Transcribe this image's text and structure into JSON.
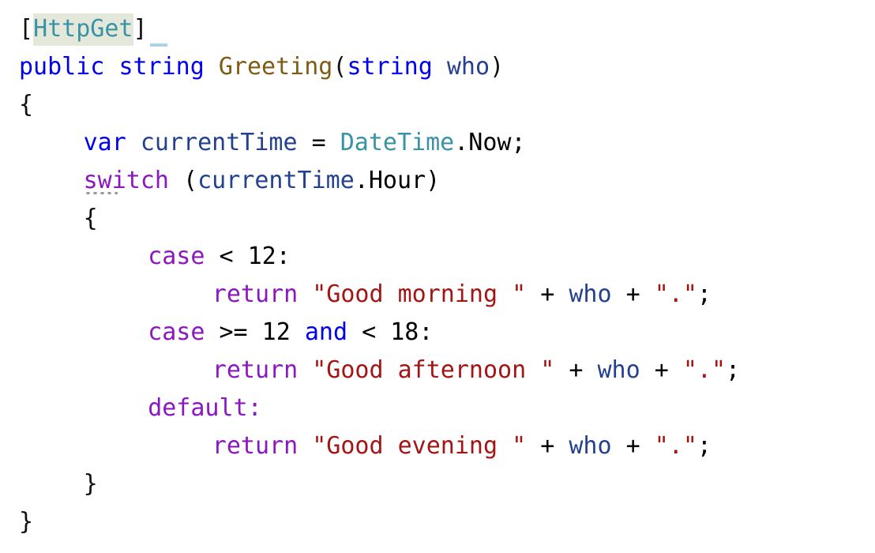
{
  "editor": {
    "language": "C#",
    "background": "#FFFFFF",
    "indent_unit": "    ",
    "colors": {
      "plain": "#000000",
      "keyword": "#0000EE",
      "control_keyword": "#8B17C0",
      "type": "#3A92A5",
      "method": "#7E5C14",
      "parameter": "#24418F",
      "local_variable": "#24418F",
      "string": "#A31515",
      "attribute_highlight_background": "#E3E8DA",
      "rename_bar": "#ADD4E6",
      "squiggle": "#9A9A9A"
    }
  },
  "code": {
    "lines": [
      {
        "n": 1,
        "indent": 0,
        "text": "[HttpGet]",
        "tokens": [
          {
            "text": "[",
            "kind": "punct"
          },
          {
            "text": "HttpGet",
            "kind": "type",
            "highlighted": true
          },
          {
            "text": "]",
            "kind": "punct"
          }
        ]
      },
      {
        "n": 2,
        "indent": 0,
        "text": "public string Greeting(string who)",
        "tokens": [
          {
            "text": "public",
            "kind": "keyword"
          },
          {
            "text": " ",
            "kind": "plain"
          },
          {
            "text": "string",
            "kind": "keyword"
          },
          {
            "text": " ",
            "kind": "plain"
          },
          {
            "text": "Greeting",
            "kind": "method"
          },
          {
            "text": "(",
            "kind": "punct"
          },
          {
            "text": "string",
            "kind": "keyword"
          },
          {
            "text": " ",
            "kind": "plain"
          },
          {
            "text": "who",
            "kind": "parameter"
          },
          {
            "text": ")",
            "kind": "punct"
          }
        ]
      },
      {
        "n": 3,
        "indent": 0,
        "text": "{",
        "tokens": [
          {
            "text": "{",
            "kind": "punct"
          }
        ]
      },
      {
        "n": 4,
        "indent": 1,
        "text": "var currentTime = DateTime.Now;",
        "tokens": [
          {
            "text": "var",
            "kind": "keyword"
          },
          {
            "text": " ",
            "kind": "plain"
          },
          {
            "text": "currentTime",
            "kind": "local"
          },
          {
            "text": " = ",
            "kind": "plain"
          },
          {
            "text": "DateTime",
            "kind": "type"
          },
          {
            "text": ".Now;",
            "kind": "plain"
          }
        ]
      },
      {
        "n": 5,
        "indent": 1,
        "text": "switch (currentTime.Hour)",
        "squiggle_under": "switch",
        "tokens": [
          {
            "text": "switch",
            "kind": "control"
          },
          {
            "text": " (",
            "kind": "plain"
          },
          {
            "text": "currentTime",
            "kind": "local"
          },
          {
            "text": ".Hour)",
            "kind": "plain"
          }
        ]
      },
      {
        "n": 6,
        "indent": 1,
        "text": "{",
        "tokens": [
          {
            "text": "{",
            "kind": "punct"
          }
        ]
      },
      {
        "n": 7,
        "indent": 2,
        "text": "case < 12:",
        "tokens": [
          {
            "text": "case",
            "kind": "control"
          },
          {
            "text": " < 12:",
            "kind": "plain"
          }
        ]
      },
      {
        "n": 8,
        "indent": 3,
        "text": "return \"Good morning \" + who + \".\";",
        "tokens": [
          {
            "text": "return",
            "kind": "control"
          },
          {
            "text": " ",
            "kind": "plain"
          },
          {
            "text": "\"Good morning \"",
            "kind": "string"
          },
          {
            "text": " + ",
            "kind": "plain"
          },
          {
            "text": "who",
            "kind": "parameter"
          },
          {
            "text": " + ",
            "kind": "plain"
          },
          {
            "text": "\".\"",
            "kind": "string"
          },
          {
            "text": ";",
            "kind": "plain"
          }
        ]
      },
      {
        "n": 9,
        "indent": 2,
        "text": "case >= 12 and < 18:",
        "tokens": [
          {
            "text": "case",
            "kind": "control"
          },
          {
            "text": " >= 12 ",
            "kind": "plain"
          },
          {
            "text": "and",
            "kind": "keyword"
          },
          {
            "text": " < 18:",
            "kind": "plain"
          }
        ]
      },
      {
        "n": 10,
        "indent": 3,
        "text": "return \"Good afternoon \" + who + \".\";",
        "tokens": [
          {
            "text": "return",
            "kind": "control"
          },
          {
            "text": " ",
            "kind": "plain"
          },
          {
            "text": "\"Good afternoon \"",
            "kind": "string"
          },
          {
            "text": " + ",
            "kind": "plain"
          },
          {
            "text": "who",
            "kind": "parameter"
          },
          {
            "text": " + ",
            "kind": "plain"
          },
          {
            "text": "\".\"",
            "kind": "string"
          },
          {
            "text": ";",
            "kind": "plain"
          }
        ]
      },
      {
        "n": 11,
        "indent": 2,
        "text": "default:",
        "tokens": [
          {
            "text": "default",
            "kind": "control"
          },
          {
            "text": ":",
            "kind": "control"
          }
        ]
      },
      {
        "n": 12,
        "indent": 3,
        "text": "return \"Good evening \" + who + \".\";",
        "tokens": [
          {
            "text": "return",
            "kind": "control"
          },
          {
            "text": " ",
            "kind": "plain"
          },
          {
            "text": "\"Good evening \"",
            "kind": "string"
          },
          {
            "text": " + ",
            "kind": "plain"
          },
          {
            "text": "who",
            "kind": "parameter"
          },
          {
            "text": " + ",
            "kind": "plain"
          },
          {
            "text": "\".\"",
            "kind": "string"
          },
          {
            "text": ";",
            "kind": "plain"
          }
        ]
      },
      {
        "n": 13,
        "indent": 1,
        "text": "}",
        "tokens": [
          {
            "text": "}",
            "kind": "punct"
          }
        ]
      },
      {
        "n": 14,
        "indent": 0,
        "text": "}",
        "tokens": [
          {
            "text": "}",
            "kind": "punct"
          }
        ]
      }
    ]
  }
}
